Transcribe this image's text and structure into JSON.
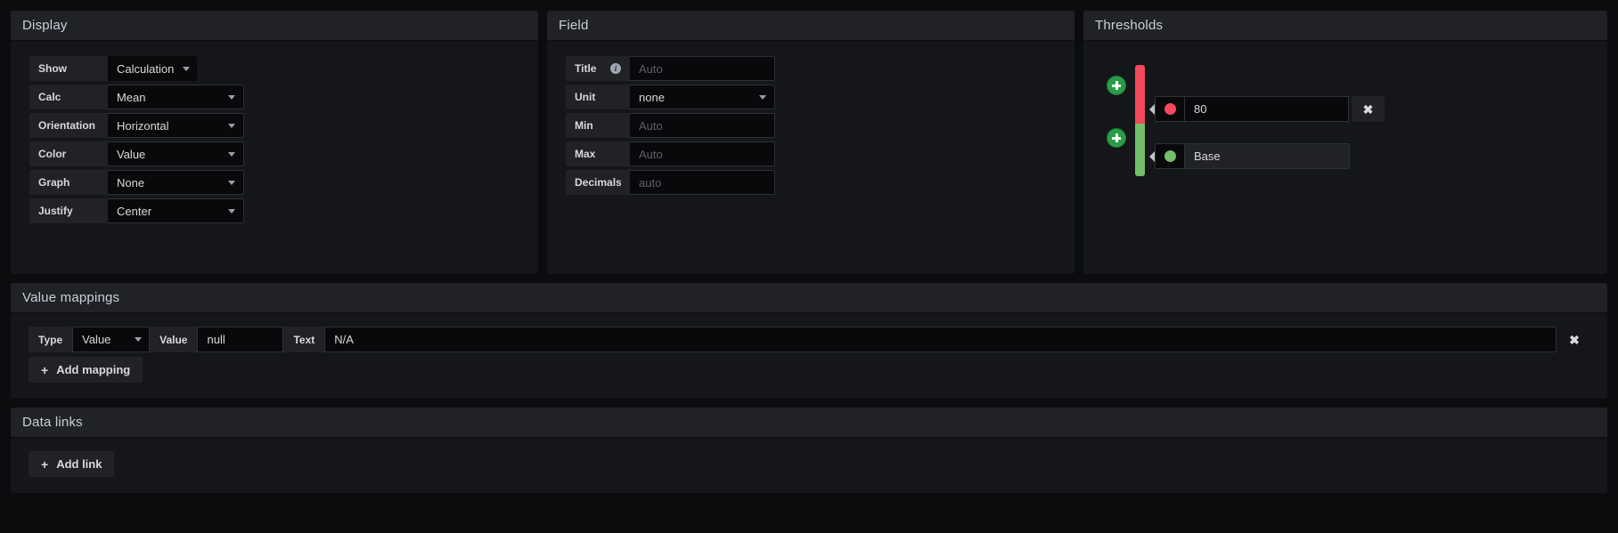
{
  "display": {
    "title": "Display",
    "rows": [
      {
        "label": "Show",
        "value": "Calculation",
        "kind": "select-inline"
      },
      {
        "label": "Calc",
        "value": "Mean",
        "kind": "select"
      },
      {
        "label": "Orientation",
        "value": "Horizontal",
        "kind": "select"
      },
      {
        "label": "Color",
        "value": "Value",
        "kind": "select"
      },
      {
        "label": "Graph",
        "value": "None",
        "kind": "select"
      },
      {
        "label": "Justify",
        "value": "Center",
        "kind": "select"
      }
    ]
  },
  "field": {
    "title": "Field",
    "rows": [
      {
        "label": "Title",
        "value": "",
        "placeholder": "Auto",
        "kind": "input",
        "info_icon": "info-icon"
      },
      {
        "label": "Unit",
        "value": "none",
        "placeholder": "",
        "kind": "select"
      },
      {
        "label": "Min",
        "value": "",
        "placeholder": "Auto",
        "kind": "input"
      },
      {
        "label": "Max",
        "value": "",
        "placeholder": "Auto",
        "kind": "input"
      },
      {
        "label": "Decimals",
        "value": "",
        "placeholder": "auto",
        "kind": "input"
      }
    ]
  },
  "thresholds": {
    "title": "Thresholds",
    "add_icon": "plus-icon",
    "delete_icon": "close-icon",
    "steps": [
      {
        "value": "80",
        "color": "#f2495c",
        "editable": true,
        "delete": "✖"
      },
      {
        "value": "Base",
        "color": "#73bf69",
        "editable": false
      }
    ],
    "bar": {
      "top_color": "#f2495c",
      "bottom_color": "#73bf69",
      "split_percent": 53
    }
  },
  "value_mappings": {
    "title": "Value mappings",
    "mapping": {
      "type_label": "Type",
      "type_value": "Value",
      "value_label": "Value",
      "value_value": "null",
      "text_label": "Text",
      "text_value": "N/A",
      "delete_icon": "✖"
    },
    "add_label": "Add mapping",
    "add_icon": "+"
  },
  "data_links": {
    "title": "Data links",
    "add_label": "Add link",
    "add_icon": "+"
  }
}
